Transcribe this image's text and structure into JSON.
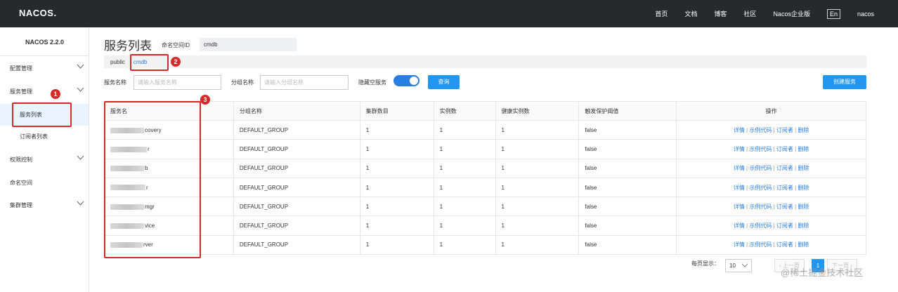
{
  "topbar": {
    "logo": "NACOS.",
    "nav": [
      "首页",
      "文档",
      "博客",
      "社区",
      "Nacos企业版"
    ],
    "lang": "En",
    "user": "nacos"
  },
  "sidebar": {
    "version": "NACOS 2.2.0",
    "items": [
      {
        "label": "配置管理",
        "expandable": true
      },
      {
        "label": "服务管理",
        "expandable": true
      },
      {
        "label": "服务列表",
        "sub": true,
        "active": true
      },
      {
        "label": "订阅者列表",
        "sub": true
      },
      {
        "label": "权限控制",
        "expandable": true
      },
      {
        "label": "命名空间",
        "expandable": false
      },
      {
        "label": "集群管理",
        "expandable": true
      }
    ]
  },
  "main": {
    "title": "服务列表",
    "namespace_label": "命名空间ID",
    "namespace_value": "cmdb",
    "namespaces": [
      "public",
      "cmdb"
    ],
    "filters": {
      "service_label": "服务名称",
      "service_placeholder": "请输入服务名称",
      "group_label": "分组名称",
      "group_placeholder": "请输入分组名称",
      "hide_empty_label": "隐藏空服务",
      "hide_empty_on": true,
      "query_button": "查询",
      "create_button": "创建服务"
    },
    "annotations": [
      "1",
      "2",
      "3"
    ],
    "table": {
      "headers": [
        "服务名",
        "分组名称",
        "集群数目",
        "实例数",
        "健康实例数",
        "触发保护阈值",
        "操作"
      ],
      "rows": [
        {
          "name_suffix": "covery",
          "group": "DEFAULT_GROUP",
          "clusters": "1",
          "instances": "1",
          "healthy": "1",
          "protect": "false"
        },
        {
          "name_suffix": "r",
          "group": "DEFAULT_GROUP",
          "clusters": "1",
          "instances": "1",
          "healthy": "1",
          "protect": "false"
        },
        {
          "name_suffix": "b",
          "group": "DEFAULT_GROUP",
          "clusters": "1",
          "instances": "1",
          "healthy": "1",
          "protect": "false"
        },
        {
          "name_suffix": "r",
          "group": "DEFAULT_GROUP",
          "clusters": "1",
          "instances": "1",
          "healthy": "1",
          "protect": "false"
        },
        {
          "name_suffix": "mgr",
          "group": "DEFAULT_GROUP",
          "clusters": "1",
          "instances": "1",
          "healthy": "1",
          "protect": "false"
        },
        {
          "name_suffix": "vice",
          "group": "DEFAULT_GROUP",
          "clusters": "1",
          "instances": "1",
          "healthy": "1",
          "protect": "false"
        },
        {
          "name_suffix": "rver",
          "group": "DEFAULT_GROUP",
          "clusters": "1",
          "instances": "1",
          "healthy": "1",
          "protect": "false"
        }
      ],
      "actions": [
        "详情",
        "示例代码",
        "订阅者",
        "删除"
      ]
    },
    "pagination": {
      "per_page_label": "每页显示：",
      "per_page": "10",
      "prev": "上一页",
      "current": "1",
      "next": "下一页"
    }
  },
  "watermark": "@稀土掘金技术社区",
  "colors": {
    "topbar": "#252a2f",
    "accent": "#2196f3",
    "annotation": "#d62a2a"
  }
}
